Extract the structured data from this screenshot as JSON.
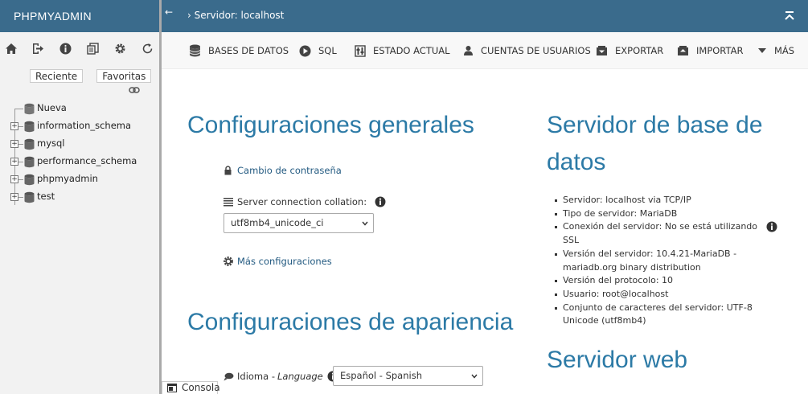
{
  "left": {
    "logo": "PHPMYADMIN",
    "tabs": {
      "recent": "Reciente",
      "favorites": "Favoritas"
    },
    "tree": [
      {
        "label": "Nueva",
        "expandable": false
      },
      {
        "label": "information_schema",
        "expandable": true
      },
      {
        "label": "mysql",
        "expandable": true
      },
      {
        "label": "performance_schema",
        "expandable": true
      },
      {
        "label": "phpmyadmin",
        "expandable": true
      },
      {
        "label": "test",
        "expandable": true
      }
    ]
  },
  "topbar": {
    "back": "←",
    "breadcrumb": "› Servidor: localhost"
  },
  "menu": {
    "databases": "BASES DE DATOS",
    "sql": "SQL",
    "status": "ESTADO ACTUAL",
    "users": "CUENTAS DE USUARIOS",
    "export": "EXPORTAR",
    "import": "IMPORTAR",
    "more": "MÁS"
  },
  "general": {
    "title": "Configuraciones generales",
    "change_password": "Cambio de contraseña",
    "collation_label": "Server connection collation:",
    "collation_value": "utf8mb4_unicode_ci",
    "more_settings": "Más configuraciones"
  },
  "appearance": {
    "title": "Configuraciones de apariencia",
    "language_label": "Idioma - ",
    "language_label_italic": "Language",
    "language_value": "Español - Spanish"
  },
  "db_server": {
    "title_line1": "Servidor de base de",
    "title_line2": "datos",
    "items": [
      "Servidor: localhost via TCP/IP",
      "Tipo de servidor: MariaDB",
      "Conexión del servidor: No se está utilizando SSL",
      "Versión del servidor: 10.4.21-MariaDB - mariadb.org binary distribution",
      "Versión del protocolo: 10",
      "Usuario: root@localhost",
      "Conjunto de caracteres del servidor: UTF-8 Unicode (utf8mb4)"
    ]
  },
  "web_server": {
    "title": "Servidor web"
  },
  "console": {
    "label": "Consola"
  },
  "colors": {
    "header": "#3a6b8c",
    "heading": "#2c7aa6",
    "link": "#235a81"
  }
}
